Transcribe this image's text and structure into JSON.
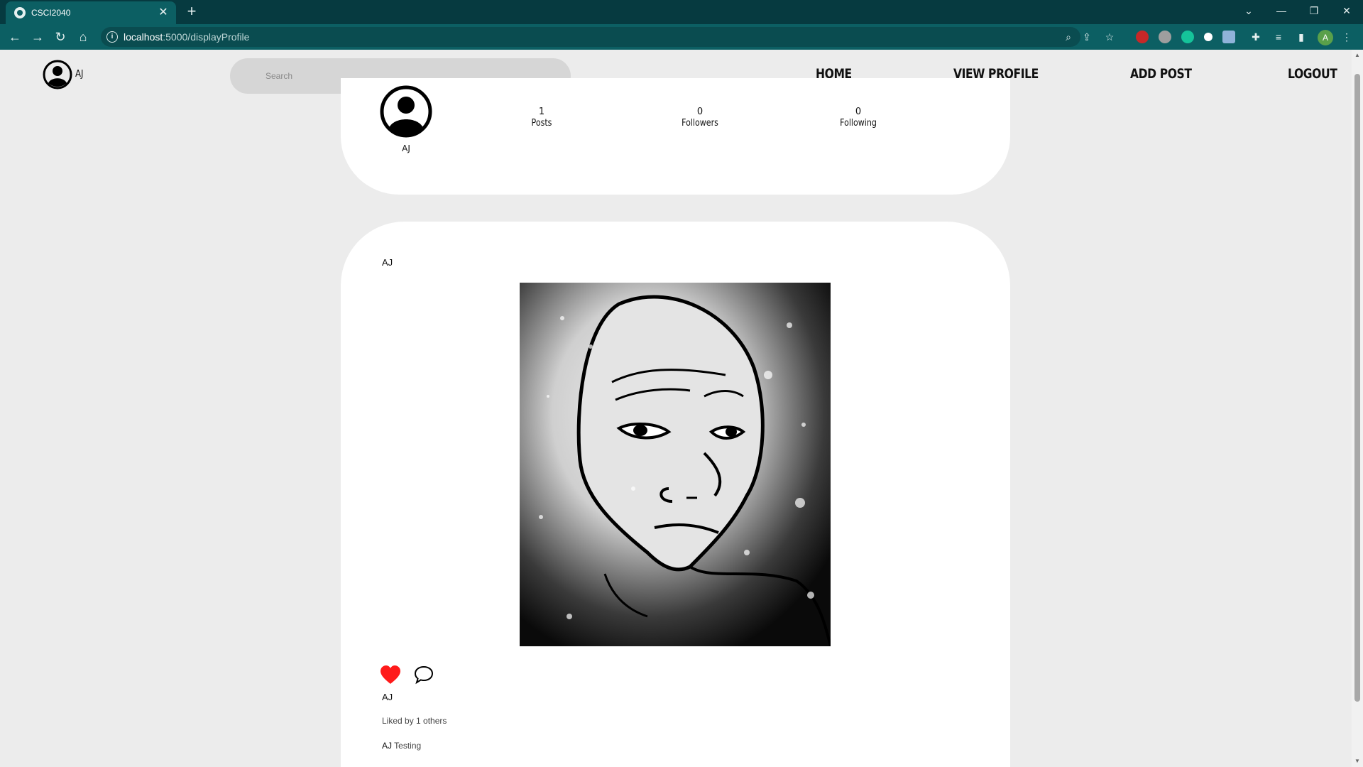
{
  "browser": {
    "tab_title": "CSCI2040",
    "url_host": "localhost",
    "url_path": ":5000/displayProfile"
  },
  "header": {
    "user_name": "AJ",
    "search_placeholder": "Search",
    "nav": {
      "home": "HOME",
      "view_profile": "VIEW PROFILE",
      "add_post": "ADD POST",
      "logout": "LOGOUT"
    }
  },
  "profile": {
    "name": "AJ",
    "stats": [
      {
        "value": "1",
        "label": "Posts"
      },
      {
        "value": "0",
        "label": "Followers"
      },
      {
        "value": "0",
        "label": "Following"
      }
    ]
  },
  "post": {
    "author": "AJ",
    "author_footer": "AJ",
    "likes_text": "Liked by 1 others",
    "caption_author": "AJ",
    "caption_text": "Testing",
    "liked": true,
    "like_color": "#ff1a1a"
  },
  "icons": {
    "back": "arrow-left-icon",
    "forward": "arrow-right-icon",
    "reload": "reload-icon",
    "home": "home-icon",
    "user": "user-circle-icon",
    "heart": "heart-icon",
    "comment": "speech-bubble-icon"
  }
}
